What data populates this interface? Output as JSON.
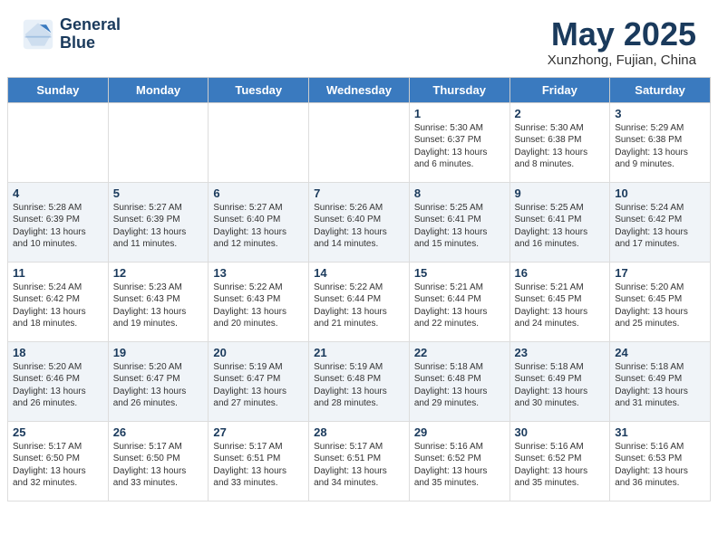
{
  "header": {
    "logo_line1": "General",
    "logo_line2": "Blue",
    "month": "May 2025",
    "location": "Xunzhong, Fujian, China"
  },
  "weekdays": [
    "Sunday",
    "Monday",
    "Tuesday",
    "Wednesday",
    "Thursday",
    "Friday",
    "Saturday"
  ],
  "weeks": [
    [
      {
        "day": "",
        "info": ""
      },
      {
        "day": "",
        "info": ""
      },
      {
        "day": "",
        "info": ""
      },
      {
        "day": "",
        "info": ""
      },
      {
        "day": "1",
        "info": "Sunrise: 5:30 AM\nSunset: 6:37 PM\nDaylight: 13 hours\nand 6 minutes."
      },
      {
        "day": "2",
        "info": "Sunrise: 5:30 AM\nSunset: 6:38 PM\nDaylight: 13 hours\nand 8 minutes."
      },
      {
        "day": "3",
        "info": "Sunrise: 5:29 AM\nSunset: 6:38 PM\nDaylight: 13 hours\nand 9 minutes."
      }
    ],
    [
      {
        "day": "4",
        "info": "Sunrise: 5:28 AM\nSunset: 6:39 PM\nDaylight: 13 hours\nand 10 minutes."
      },
      {
        "day": "5",
        "info": "Sunrise: 5:27 AM\nSunset: 6:39 PM\nDaylight: 13 hours\nand 11 minutes."
      },
      {
        "day": "6",
        "info": "Sunrise: 5:27 AM\nSunset: 6:40 PM\nDaylight: 13 hours\nand 12 minutes."
      },
      {
        "day": "7",
        "info": "Sunrise: 5:26 AM\nSunset: 6:40 PM\nDaylight: 13 hours\nand 14 minutes."
      },
      {
        "day": "8",
        "info": "Sunrise: 5:25 AM\nSunset: 6:41 PM\nDaylight: 13 hours\nand 15 minutes."
      },
      {
        "day": "9",
        "info": "Sunrise: 5:25 AM\nSunset: 6:41 PM\nDaylight: 13 hours\nand 16 minutes."
      },
      {
        "day": "10",
        "info": "Sunrise: 5:24 AM\nSunset: 6:42 PM\nDaylight: 13 hours\nand 17 minutes."
      }
    ],
    [
      {
        "day": "11",
        "info": "Sunrise: 5:24 AM\nSunset: 6:42 PM\nDaylight: 13 hours\nand 18 minutes."
      },
      {
        "day": "12",
        "info": "Sunrise: 5:23 AM\nSunset: 6:43 PM\nDaylight: 13 hours\nand 19 minutes."
      },
      {
        "day": "13",
        "info": "Sunrise: 5:22 AM\nSunset: 6:43 PM\nDaylight: 13 hours\nand 20 minutes."
      },
      {
        "day": "14",
        "info": "Sunrise: 5:22 AM\nSunset: 6:44 PM\nDaylight: 13 hours\nand 21 minutes."
      },
      {
        "day": "15",
        "info": "Sunrise: 5:21 AM\nSunset: 6:44 PM\nDaylight: 13 hours\nand 22 minutes."
      },
      {
        "day": "16",
        "info": "Sunrise: 5:21 AM\nSunset: 6:45 PM\nDaylight: 13 hours\nand 24 minutes."
      },
      {
        "day": "17",
        "info": "Sunrise: 5:20 AM\nSunset: 6:45 PM\nDaylight: 13 hours\nand 25 minutes."
      }
    ],
    [
      {
        "day": "18",
        "info": "Sunrise: 5:20 AM\nSunset: 6:46 PM\nDaylight: 13 hours\nand 26 minutes."
      },
      {
        "day": "19",
        "info": "Sunrise: 5:20 AM\nSunset: 6:47 PM\nDaylight: 13 hours\nand 26 minutes."
      },
      {
        "day": "20",
        "info": "Sunrise: 5:19 AM\nSunset: 6:47 PM\nDaylight: 13 hours\nand 27 minutes."
      },
      {
        "day": "21",
        "info": "Sunrise: 5:19 AM\nSunset: 6:48 PM\nDaylight: 13 hours\nand 28 minutes."
      },
      {
        "day": "22",
        "info": "Sunrise: 5:18 AM\nSunset: 6:48 PM\nDaylight: 13 hours\nand 29 minutes."
      },
      {
        "day": "23",
        "info": "Sunrise: 5:18 AM\nSunset: 6:49 PM\nDaylight: 13 hours\nand 30 minutes."
      },
      {
        "day": "24",
        "info": "Sunrise: 5:18 AM\nSunset: 6:49 PM\nDaylight: 13 hours\nand 31 minutes."
      }
    ],
    [
      {
        "day": "25",
        "info": "Sunrise: 5:17 AM\nSunset: 6:50 PM\nDaylight: 13 hours\nand 32 minutes."
      },
      {
        "day": "26",
        "info": "Sunrise: 5:17 AM\nSunset: 6:50 PM\nDaylight: 13 hours\nand 33 minutes."
      },
      {
        "day": "27",
        "info": "Sunrise: 5:17 AM\nSunset: 6:51 PM\nDaylight: 13 hours\nand 33 minutes."
      },
      {
        "day": "28",
        "info": "Sunrise: 5:17 AM\nSunset: 6:51 PM\nDaylight: 13 hours\nand 34 minutes."
      },
      {
        "day": "29",
        "info": "Sunrise: 5:16 AM\nSunset: 6:52 PM\nDaylight: 13 hours\nand 35 minutes."
      },
      {
        "day": "30",
        "info": "Sunrise: 5:16 AM\nSunset: 6:52 PM\nDaylight: 13 hours\nand 35 minutes."
      },
      {
        "day": "31",
        "info": "Sunrise: 5:16 AM\nSunset: 6:53 PM\nDaylight: 13 hours\nand 36 minutes."
      }
    ]
  ]
}
